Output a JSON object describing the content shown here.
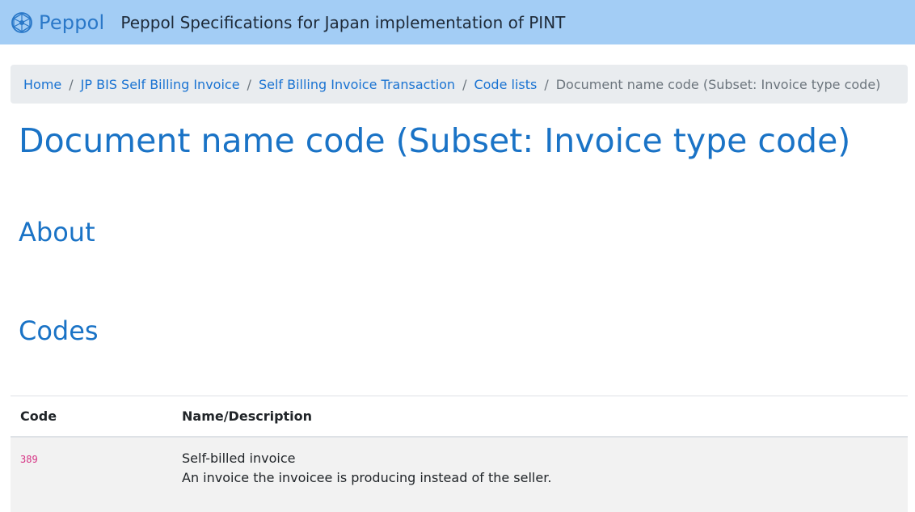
{
  "header": {
    "brand_name": "Peppol",
    "site_title": "Peppol Specifications for Japan implementation of PINT",
    "colors": {
      "bar": "#a3cdf5",
      "brand": "#2a78c8"
    }
  },
  "breadcrumb": {
    "items": [
      {
        "label": "Home"
      },
      {
        "label": "JP BIS Self Billing Invoice"
      },
      {
        "label": "Self Billing Invoice Transaction"
      },
      {
        "label": "Code lists"
      }
    ],
    "separator": "/",
    "current": "Document name code (Subset: Invoice type code)"
  },
  "page": {
    "title": "Document name code (Subset: Invoice type code)",
    "sections": {
      "about": "About",
      "codes": "Codes"
    }
  },
  "codes_table": {
    "headers": {
      "code": "Code",
      "name": "Name/Description"
    },
    "rows": [
      {
        "code": "389",
        "name": "Self-billed invoice",
        "description": "An invoice the invoicee is producing instead of the seller."
      }
    ]
  },
  "colors": {
    "heading": "#1a73c6",
    "link": "#1a73d2",
    "code": "#d63384",
    "row_bg": "#f2f2f2"
  }
}
